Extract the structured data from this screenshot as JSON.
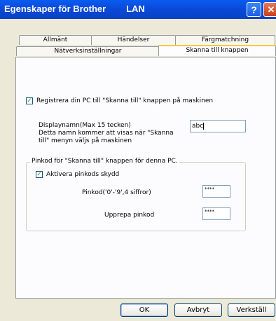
{
  "window": {
    "title": "Egenskaper för Brother        LAN",
    "help_glyph": "?",
    "close_glyph": "✕"
  },
  "tabs_row1": [
    "Allmänt",
    "Händelser",
    "Färgmatchning"
  ],
  "tabs_row2": [
    "Nätverksinställningar",
    "Skanna till knappen"
  ],
  "register": {
    "label": "Registrera din PC till \"Skanna till\" knappen på maskinen",
    "checked": true
  },
  "display_name": {
    "line1": "Displaynamn(Max 15 tecken)",
    "line2": "Detta namn kommer att visas när \"Skanna",
    "line3": "till\" menyn väljs på maskinen",
    "value": "abc"
  },
  "pin_group": {
    "title": "Pinkod för \"Skanna till\" knappen för denna PC.",
    "activate_label": "Aktivera pinkods skydd",
    "activate_checked": true,
    "pin_label": "Pinkod('0'-'9',4 siffror)",
    "pin_value": "****",
    "repeat_label": "Upprepa pinkod",
    "repeat_value": "****"
  },
  "buttons": {
    "ok": "OK",
    "cancel": "Avbryt",
    "apply": "Verkställ"
  }
}
